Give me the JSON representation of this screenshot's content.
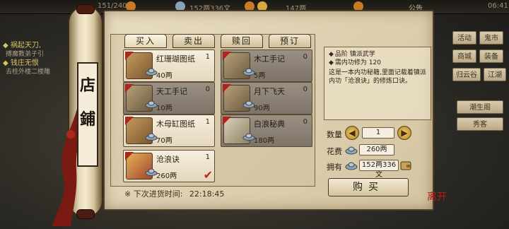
{
  "topbar": {
    "stamina": "151/240",
    "money": "152两336文",
    "gold": "147两",
    "notice": "公告",
    "time": "06:41"
  },
  "quests": [
    {
      "title": "◆ 祸起天刀,",
      "desc": "搏魔教弟子引"
    },
    {
      "title": "◆ 钱庄无恨",
      "desc": "去桂外楼二楼雕"
    }
  ],
  "right_menu": [
    "活动",
    "鬼市",
    "商城",
    "装备",
    "归云谷",
    "江湖",
    "潮生阁",
    "秀客"
  ],
  "shop": {
    "sign": [
      "店",
      "鋪"
    ],
    "tabs": [
      "买入",
      "卖出",
      "赎回",
      "预订"
    ],
    "items": [
      {
        "name": "红珊瑚图纸",
        "qty": "1",
        "price": "40两",
        "style": "light",
        "thumb": "scroll-icon"
      },
      {
        "name": "木工手记",
        "qty": "0",
        "price": "5两",
        "style": "dark",
        "thumb": "book-icon"
      },
      {
        "name": "天工手记",
        "qty": "0",
        "price": "10两",
        "style": "dark",
        "thumb": "book-icon"
      },
      {
        "name": "月下飞天",
        "qty": "0",
        "price": "90两",
        "style": "dark",
        "thumb": "book-icon"
      },
      {
        "name": "木母缸图纸",
        "qty": "1",
        "price": "70两",
        "style": "light",
        "thumb": "scroll-icon"
      },
      {
        "name": "白浪秘典",
        "qty": "0",
        "price": "180两",
        "style": "dark",
        "thumb": "cloth-icon"
      },
      {
        "name": "沧浪诀",
        "qty": "1",
        "price": "260两",
        "style": "light",
        "thumb": "gift-icon",
        "selected": true
      }
    ],
    "restock_label": "※ 下次进货时间:",
    "restock_time": "22:18:45"
  },
  "detail": {
    "line1": "品阶 镇派武学",
    "line2": "需内功修为 120",
    "description": "这是一本内功秘籍,里面记载着镇派内功「沧浪诀」的修炼口诀。",
    "quantity_label": "数量",
    "quantity": "1",
    "cost_label": "花费",
    "cost": "260两",
    "owned_label": "拥有",
    "owned": "152两336文",
    "buy_label": "购买",
    "close_stamp": "离开"
  }
}
